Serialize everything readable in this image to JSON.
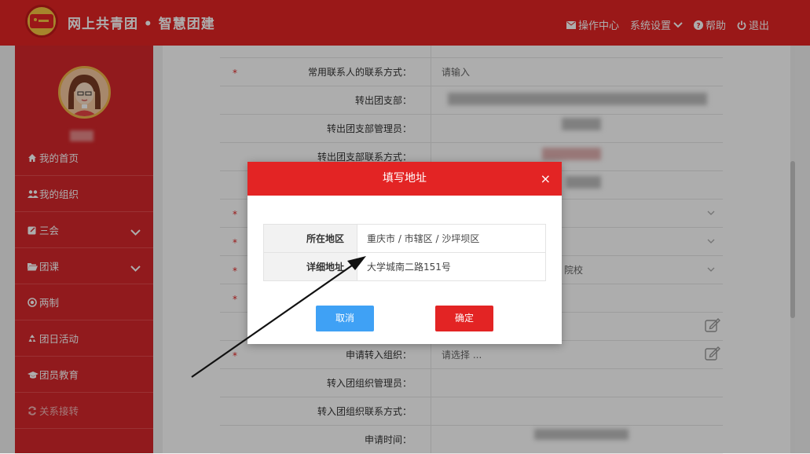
{
  "header": {
    "app_title": "网上共青团 • 智慧团建",
    "nav": [
      {
        "label": "操作中心",
        "icon": "envelope-icon"
      },
      {
        "label": "系统设置",
        "icon": "chevron-down-icon"
      },
      {
        "label": "帮助",
        "icon": "question-circle-icon"
      },
      {
        "label": "退出",
        "icon": "power-icon"
      }
    ]
  },
  "sidebar": {
    "items": [
      {
        "label": "我的首页",
        "icon": "home-icon"
      },
      {
        "label": "我的组织",
        "icon": "users-icon"
      },
      {
        "label": "三会",
        "icon": "edit-icon",
        "expandable": true
      },
      {
        "label": "团课",
        "icon": "folder-open-icon",
        "expandable": true
      },
      {
        "label": "两制",
        "icon": "circle-dot-icon"
      },
      {
        "label": "团日活动",
        "icon": "recycle-icon"
      },
      {
        "label": "团员教育",
        "icon": "graduation-cap-icon"
      },
      {
        "label": "关系接转",
        "icon": "refresh-icon"
      }
    ]
  },
  "form": {
    "rows": [
      {
        "label": "常用联系人的联系方式：",
        "required": true,
        "value": "请输入"
      },
      {
        "label": "转出团支部：",
        "required": false,
        "value": ""
      },
      {
        "label": "转出团支部管理员：",
        "required": false,
        "value": ""
      },
      {
        "label": "转出团支部联系方式：",
        "required": false,
        "value": ""
      },
      {
        "label": "",
        "required": false,
        "value": ""
      },
      {
        "label": "",
        "required": true,
        "value": ""
      },
      {
        "label": "",
        "required": true,
        "value": ""
      },
      {
        "label": "",
        "required": true,
        "value": "院校"
      },
      {
        "label": "",
        "required": true,
        "value": ""
      },
      {
        "label": "",
        "required": false,
        "value": ""
      },
      {
        "label": "申请转入组织：",
        "required": true,
        "value": "请选择 ..."
      },
      {
        "label": "转入团组织管理员：",
        "required": false,
        "value": ""
      },
      {
        "label": "转入团组织联系方式：",
        "required": false,
        "value": ""
      },
      {
        "label": "申请时间：",
        "required": false,
        "value": ""
      }
    ]
  },
  "modal": {
    "title": "填写地址",
    "close": "×",
    "fields": [
      {
        "key": "所在地区",
        "value": "重庆市 / 市辖区 / 沙坪坝区"
      },
      {
        "key": "详细地址",
        "value": "大学城南二路151号"
      }
    ],
    "cancel_label": "取消",
    "confirm_label": "确定"
  },
  "colors": {
    "brand_red": "#e32424",
    "sidebar_red": "#d6272b",
    "cancel_blue": "#3fa1f5"
  }
}
